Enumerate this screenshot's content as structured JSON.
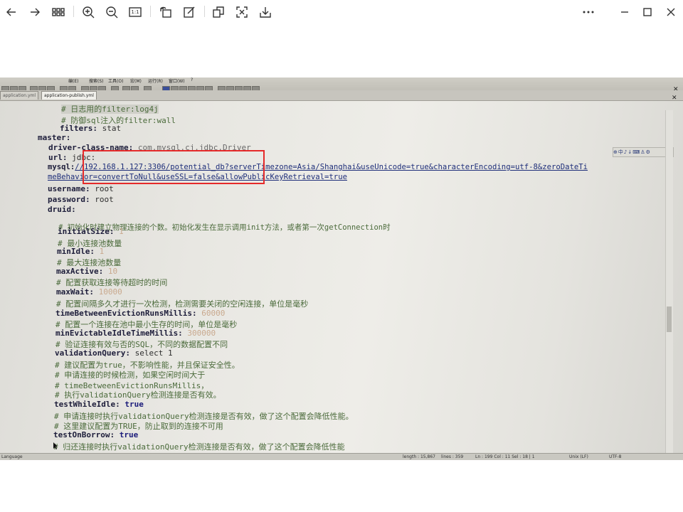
{
  "toolbar": {
    "left": [
      {
        "name": "back-icon",
        "label": "Back"
      },
      {
        "name": "forward-icon",
        "label": "Forward"
      },
      {
        "name": "grid-view-icon",
        "label": "Thumbnails"
      },
      {
        "name": "zoom-in-icon",
        "label": "Zoom in"
      },
      {
        "name": "zoom-out-icon",
        "label": "Zoom out"
      },
      {
        "name": "actual-size-icon",
        "label": "1:1"
      },
      {
        "name": "rotate-icon",
        "label": "Rotate"
      },
      {
        "name": "edit-icon",
        "label": "Edit"
      },
      {
        "name": "copy-icon",
        "label": "Copy"
      },
      {
        "name": "scan-text-icon",
        "label": "Extract text"
      },
      {
        "name": "download-icon",
        "label": "Save"
      }
    ],
    "actual_size_text": "1:1",
    "right": [
      {
        "name": "more-icon",
        "label": "More"
      },
      {
        "name": "minimize-icon",
        "label": "Minimize"
      },
      {
        "name": "maximize-icon",
        "label": "Maximize"
      },
      {
        "name": "close-icon",
        "label": "Close"
      }
    ]
  },
  "photo": {
    "menu_items": [
      "编(E)",
      "搜索(S)",
      "视图(V)",
      "格式(T)",
      "语言(L)",
      "设置(T)",
      "工具(O)",
      "宏(M)",
      "运行(R)",
      "插件(P)",
      "窗口(W)",
      "?"
    ],
    "tabs": [
      "application.yml",
      "application-publish.yml"
    ],
    "code": {
      "l1": "# 日志用的filter:log4j",
      "l2": "# 防御sql注入的filter:wall",
      "l3_key": "filters:",
      "l3_val": " stat",
      "l4": "master:",
      "l5_key": "driver-class-name:",
      "l5_val": " com.mysql.cj.jdbc.Driver",
      "l6_key": "url:",
      "l6_val": " jdbc:",
      "l7_a": "mysql:",
      "l7_b": "//192.168.1.127:3306/potential_db?serverTimezone=Asia/Shanghai&useUnicode=true&characterEncoding=utf-8&zeroDateTi",
      "l8": "meBehavior=convertToNull&useSSL=false&allowPublicKeyRetrieval=true",
      "l9_key": "username:",
      "l9_val": " root",
      "l10_key": "password:",
      "l10_val": " root",
      "l11": "druid:",
      "l12": "# 初始化时建立物理连接的个数。初始化发生在显示调用init方法，或者第一次getConnection时",
      "l13_key": "initialSize:",
      "l13_val": " 1",
      "l14": "# 最小连接池数量",
      "l15_key": "minIdle:",
      "l15_val": " 1",
      "l16": "# 最大连接池数量",
      "l17_key": "maxActive:",
      "l17_val": " 10",
      "l18": "# 配置获取连接等待超时的时间",
      "l19_key": "maxWait:",
      "l19_val": " 10000",
      "l20": "# 配置间隔多久才进行一次检测，检测需要关闭的空闲连接，单位是毫秒",
      "l21_key": "timeBetweenEvictionRunsMillis:",
      "l21_val": " 60000",
      "l22": "# 配置一个连接在池中最小生存的时间，单位是毫秒",
      "l23_key": "minEvictableIdleTimeMillis:",
      "l23_val": " 300000",
      "l24": "# 验证连接有效与否的SQL，不同的数据配置不同",
      "l25_key": "validationQuery:",
      "l25_val": " select 1",
      "l26": "# 建议配置为true，不影响性能，并且保证安全性。",
      "l27": "# 申请连接的时候检测，如果空闲时间大于",
      "l28": "# timeBetweenEvictionRunsMillis，",
      "l29": "# 执行validationQuery检测连接是否有效。",
      "l30_key": "testWhileIdle:",
      "l30_val": " true",
      "l31": "# 申请连接时执行validationQuery检测连接是否有效，做了这个配置会降低性能。",
      "l32": "# 这里建议配置为TRUE，防止取到的连接不可用",
      "l33_key": "testOnBorrow:",
      "l33_val": " true",
      "l34": "# 归还连接时执行validationQuery检测连接是否有效，做了这个配置会降低性能"
    },
    "status": {
      "lang": "Language",
      "length": "length : 15,867",
      "lines": "lines : 359",
      "pos": "Ln : 199   Col : 11   Sel : 18 | 1",
      "eol": "Unix (LF)",
      "enc": "UTF-8"
    },
    "mini_tools": "⊕中♪↓⌨♙⚙"
  }
}
